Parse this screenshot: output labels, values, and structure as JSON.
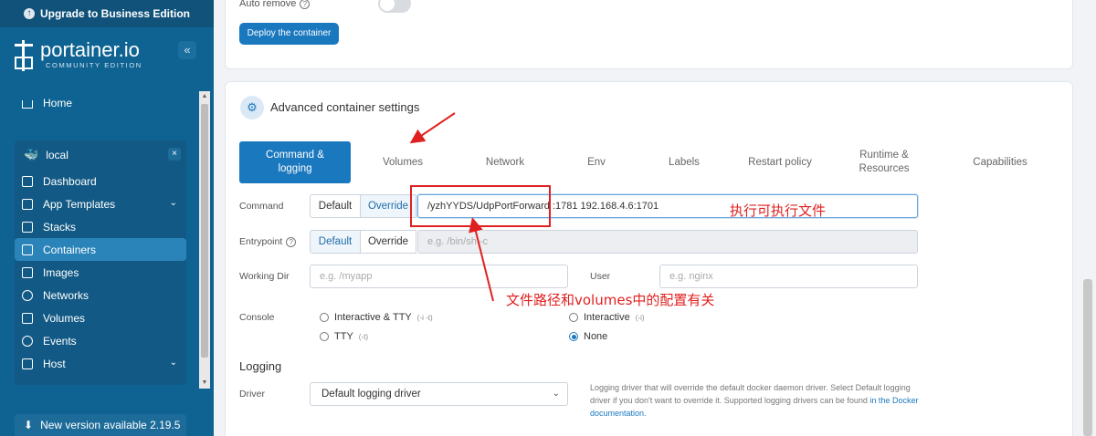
{
  "sidebar": {
    "upgrade": "Upgrade to Business Edition",
    "brand_name": "portainer.io",
    "brand_sub": "COMMUNITY EDITION",
    "collapse": "«",
    "home": "Home",
    "environment": "local",
    "close": "×",
    "items": [
      {
        "label": "Dashboard"
      },
      {
        "label": "App Templates"
      },
      {
        "label": "Stacks"
      },
      {
        "label": "Containers"
      },
      {
        "label": "Images"
      },
      {
        "label": "Networks"
      },
      {
        "label": "Volumes"
      },
      {
        "label": "Events"
      },
      {
        "label": "Host"
      }
    ],
    "new_version": "New version available 2.19.5"
  },
  "top_card": {
    "auto_remove": "Auto remove",
    "help": "?",
    "deploy": "Deploy the container"
  },
  "advanced": {
    "title": "Advanced container settings",
    "tabs": [
      {
        "label": "Command & logging"
      },
      {
        "label": "Volumes"
      },
      {
        "label": "Network"
      },
      {
        "label": "Env"
      },
      {
        "label": "Labels"
      },
      {
        "label": "Restart policy"
      },
      {
        "label": "Runtime & Resources"
      },
      {
        "label": "Capabilities"
      }
    ],
    "command_label": "Command",
    "entrypoint_label": "Entrypoint",
    "default": "Default",
    "override": "Override",
    "command_value": "/yzhYYDS/UdpPortForward :1781   192.168.4.6:1701",
    "entrypoint_placeholder": "e.g. /bin/sh -c",
    "working_dir_label": "Working Dir",
    "working_dir_placeholder": "e.g. /myapp",
    "user_label": "User",
    "user_placeholder": "e.g. nginx",
    "console_label": "Console",
    "console_options": [
      {
        "label": "Interactive & TTY",
        "hint": "(-i -t)",
        "selected": false
      },
      {
        "label": "TTY",
        "hint": "(-t)",
        "selected": false
      },
      {
        "label": "Interactive",
        "hint": "(-i)",
        "selected": false
      },
      {
        "label": "None",
        "hint": "",
        "selected": true
      }
    ]
  },
  "logging": {
    "title": "Logging",
    "driver_label": "Driver",
    "driver_value": "Default logging driver",
    "help_text": "Logging driver that will override the default docker daemon driver. Select Default logging driver if you don't want to override it. Supported logging drivers can be found",
    "help_link": "in the Docker documentation."
  },
  "annotations": {
    "exec_note": "执行可执行文件",
    "path_note": "文件路径和volumes中的配置有关",
    "color": "#e02020"
  },
  "colors": {
    "sidebar": "#0f6392",
    "accent": "#1a78bf"
  }
}
